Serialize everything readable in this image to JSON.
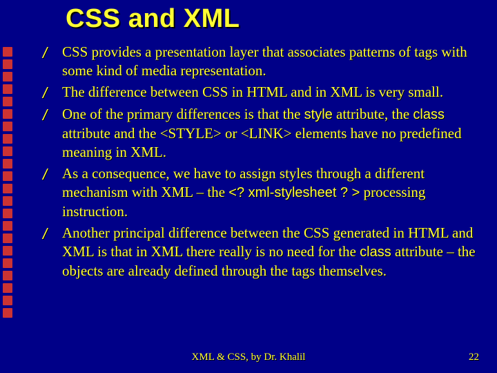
{
  "title": "CSS and XML",
  "bullets": [
    {
      "html": "CSS provides a presentation layer that associates patterns of tags with some kind of media representation."
    },
    {
      "html": "The difference between CSS in HTML and in XML is very small."
    },
    {
      "html": "One of the primary differences is that the <span class='code'>style</span> attribute, the <span class='code'>class</span> attribute and the &lt;STYLE&gt; or &lt;LINK&gt; elements have no predefined meaning in XML."
    },
    {
      "html": "As a consequence, we have to assign styles through a different mechanism with XML – the <span class='code'>&lt;? xml-stylesheet ? &gt;</span> processing instruction."
    },
    {
      "html": "Another principal difference between the CSS generated in HTML and XML is that in XML there really is no need for the <span class='code'>class</span> attribute – the objects are already defined through the tags themselves."
    }
  ],
  "footer": {
    "center": "XML & CSS, by Dr. Khalil",
    "page": "22"
  },
  "decor": {
    "square_count": 22,
    "bullet_mark": "/"
  }
}
